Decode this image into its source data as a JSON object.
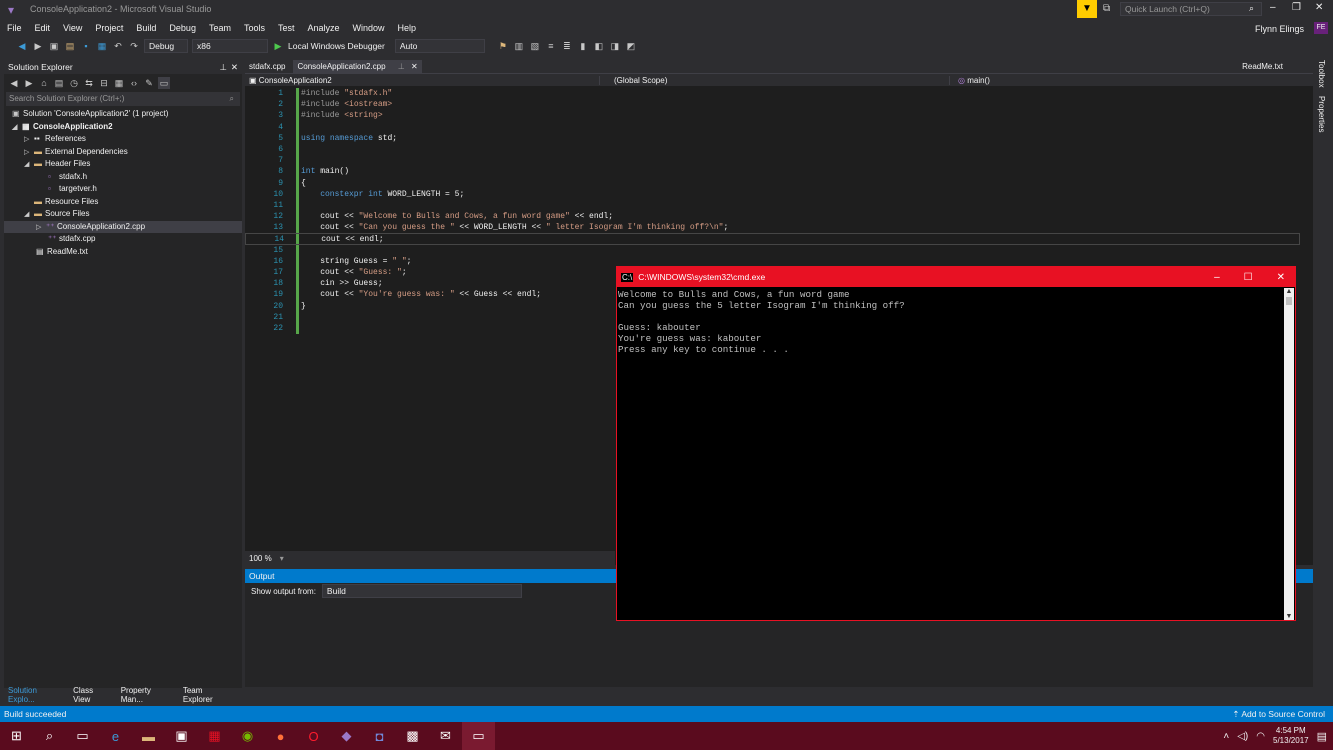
{
  "window": {
    "title": "ConsoleApplication2 - Microsoft Visual Studio",
    "quick_launch_placeholder": "Quick Launch (Ctrl+Q)",
    "user": "Flynn Elings",
    "user_initials": "FE"
  },
  "menu": [
    "File",
    "Edit",
    "View",
    "Project",
    "Build",
    "Debug",
    "Team",
    "Tools",
    "Test",
    "Analyze",
    "Window",
    "Help"
  ],
  "toolbar": {
    "config": "Debug",
    "platform": "x86",
    "debugger": "Local Windows Debugger",
    "auto": "Auto"
  },
  "solution_explorer": {
    "title": "Solution Explorer",
    "search_placeholder": "Search Solution Explorer (Ctrl+;)",
    "items": [
      {
        "label": "Solution 'ConsoleApplication2' (1 project)",
        "indent": 0
      },
      {
        "label": "ConsoleApplication2",
        "indent": 1
      },
      {
        "label": "References",
        "indent": 2
      },
      {
        "label": "External Dependencies",
        "indent": 2
      },
      {
        "label": "Header Files",
        "indent": 2
      },
      {
        "label": "stdafx.h",
        "indent": 3
      },
      {
        "label": "targetver.h",
        "indent": 3
      },
      {
        "label": "Resource Files",
        "indent": 2
      },
      {
        "label": "Source Files",
        "indent": 2
      },
      {
        "label": "ConsoleApplication2.cpp",
        "indent": 3
      },
      {
        "label": "stdafx.cpp",
        "indent": 3
      },
      {
        "label": "ReadMe.txt",
        "indent": 2
      }
    ],
    "bottom_tabs": [
      "Solution Explo...",
      "Class View",
      "Property Man...",
      "Team Explorer"
    ]
  },
  "editor": {
    "tabs": [
      "stdafx.cpp",
      "ConsoleApplication2.cpp"
    ],
    "right_tab": "ReadMe.txt",
    "nav": {
      "project": "ConsoleApplication2",
      "scope": "(Global Scope)",
      "member": "main()"
    },
    "zoom": "100 %",
    "lines": [
      "#include \"stdafx.h\"",
      "#include <iostream>",
      "#include <string>",
      "",
      "using namespace std;",
      "",
      "",
      "int main()",
      "{",
      "    constexpr int WORD_LENGTH = 5;",
      "",
      "    cout << \"Welcome to Bulls and Cows, a fun word game\" << endl;",
      "    cout << \"Can you guess the \" << WORD_LENGTH << \" letter Isogram I'm thinking off?\\n\";",
      "    cout << endl;",
      "",
      "    string Guess = \" \";",
      "    cout << \"Guess: \";",
      "    cin >> Guess;",
      "    cout << \"You're guess was: \" << Guess << endl;",
      "}",
      "",
      ""
    ]
  },
  "output": {
    "title": "Output",
    "show_from_label": "Show output from:",
    "source": "Build"
  },
  "statusbar": {
    "left": "Build succeeded",
    "right": "Add to Source Control"
  },
  "cmd": {
    "title": "C:\\WINDOWS\\system32\\cmd.exe",
    "lines": [
      "Welcome to Bulls and Cows, a fun word game",
      "Can you guess the 5 letter Isogram I'm thinking off?",
      "",
      "Guess: kabouter",
      "You're guess was: kabouter",
      "Press any key to continue . . ."
    ]
  },
  "taskbar": {
    "time": "4:54 PM",
    "date": "5/13/2017"
  },
  "side_tabs": [
    "Toolbox",
    "Properties"
  ]
}
